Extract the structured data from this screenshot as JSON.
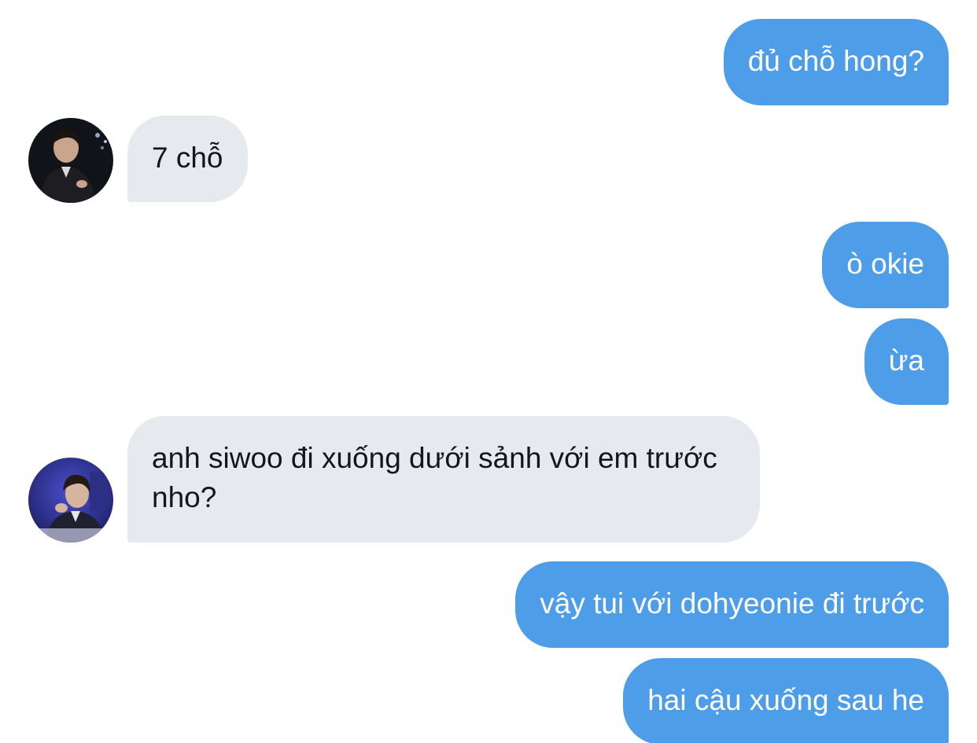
{
  "conversation": {
    "messages": [
      {
        "side": "outgoing",
        "text": "đủ chỗ hong?"
      },
      {
        "side": "incoming",
        "text": "7 chỗ",
        "avatar": "avatar-1"
      },
      {
        "side": "outgoing",
        "text": "ò okie"
      },
      {
        "side": "outgoing",
        "text": "ừa"
      },
      {
        "side": "incoming",
        "text": "anh siwoo đi xuống dưới sảnh với em trước nho?",
        "avatar": "avatar-2"
      },
      {
        "side": "outgoing",
        "text": "vậy tui với dohyeonie đi trước"
      },
      {
        "side": "outgoing",
        "text": "hai cậu xuống sau he"
      }
    ]
  },
  "colors": {
    "outgoing_bubble": "#4d9de8",
    "incoming_bubble": "#e6e9ed",
    "background": "#ffffff"
  }
}
